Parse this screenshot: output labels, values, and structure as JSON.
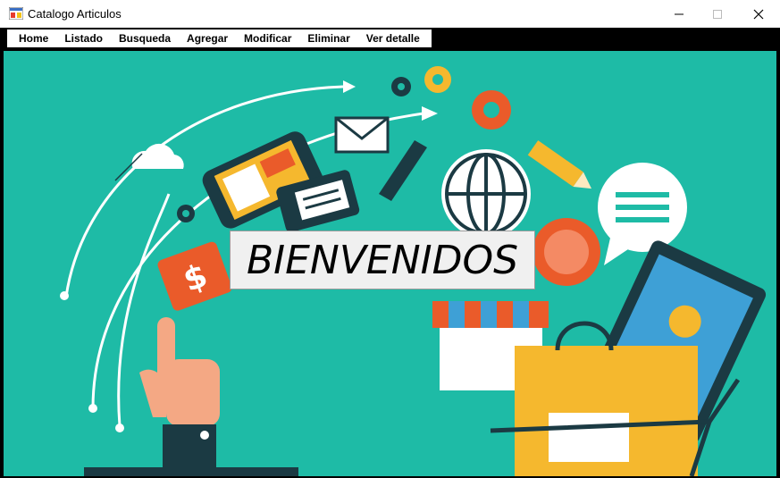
{
  "window": {
    "title": "Catalogo Articulos",
    "icons": {
      "app": "app-icon",
      "minimize": "minimize-icon",
      "maximize": "maximize-icon",
      "close": "close-icon"
    }
  },
  "menu": {
    "items": [
      "Home",
      "Listado",
      "Busqueda",
      "Agregar",
      "Modificar",
      "Eliminar",
      "Ver detalle"
    ]
  },
  "main": {
    "welcome_text": "BIENVENIDOS",
    "background": "#1ebba6"
  }
}
